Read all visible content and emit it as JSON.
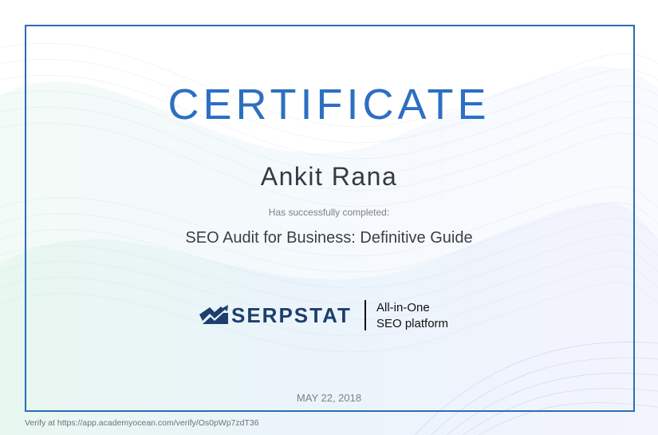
{
  "certificate": {
    "title": "CERTIFICATE",
    "recipient_name": "Ankit Rana",
    "completed_label": "Has successfully completed:",
    "course_title": "SEO Audit for Business: Definitive Guide",
    "date": "MAY 22, 2018"
  },
  "branding": {
    "logo_text": "SERPSTAT",
    "tagline_line1": "All-in-One",
    "tagline_line2": "SEO platform",
    "logo_icon": "serpstat-logo-icon",
    "brand_color": "#1d3e6e",
    "accent_color": "#2d6fc2"
  },
  "footer": {
    "verify_text": "Verify at https://app.academyocean.com/verify/Os0pWp7zdT36"
  }
}
